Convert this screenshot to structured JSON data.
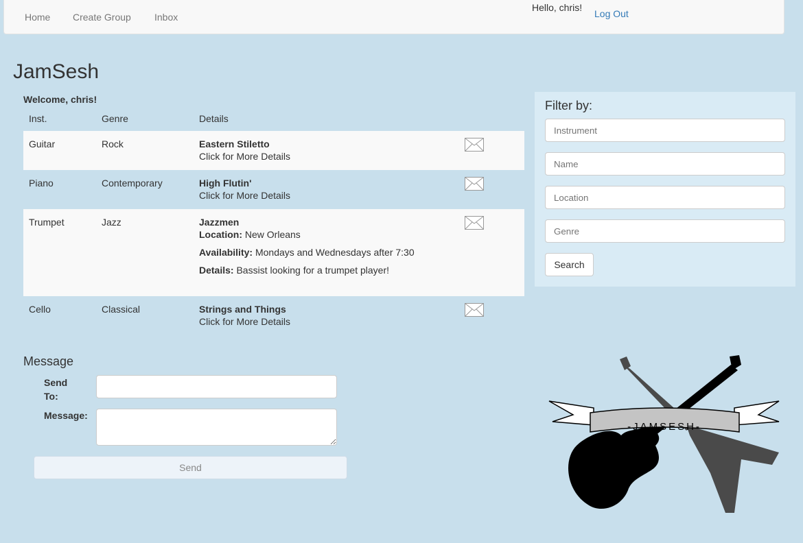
{
  "nav": {
    "home": "Home",
    "create_group": "Create Group",
    "inbox": "Inbox",
    "hello": "Hello, chris!",
    "logout": "Log Out"
  },
  "app_title": "JamSesh",
  "welcome": "Welcome, chris!",
  "table": {
    "headers": {
      "inst": "Inst.",
      "genre": "Genre",
      "details": "Details"
    },
    "rows": [
      {
        "inst": "Guitar",
        "genre": "Rock",
        "title": "Eastern Stiletto",
        "more": "Click for More Details"
      },
      {
        "inst": "Piano",
        "genre": "Contemporary",
        "title": "High Flutin'",
        "more": "Click for More Details"
      },
      {
        "inst": "Trumpet",
        "genre": "Jazz",
        "title": "Jazzmen",
        "location_label": "Location:",
        "location": "New Orleans",
        "availability_label": "Availability:",
        "availability": "Mondays and Wednesdays after 7:30",
        "details_label": "Details:",
        "details": "Bassist looking for a trumpet player!"
      },
      {
        "inst": "Cello",
        "genre": "Classical",
        "title": "Strings and Things",
        "more": "Click for More Details"
      }
    ],
    "icon": "envelope-icon"
  },
  "message": {
    "title": "Message",
    "send_to_label": "Send To:",
    "message_label": "Message:",
    "send_to_value": "",
    "message_value": "",
    "send_label": "Send"
  },
  "filter": {
    "title": "Filter by:",
    "instrument_placeholder": "Instrument",
    "name_placeholder": "Name",
    "location_placeholder": "Location",
    "genre_placeholder": "Genre",
    "search_label": "Search"
  },
  "logo": {
    "text": "-JAMSESH-",
    "icon": "crossed-guitars-logo"
  },
  "colors": {
    "background": "#c8dfec",
    "filter_bg": "#d9ebf5",
    "link": "#337ab7"
  }
}
